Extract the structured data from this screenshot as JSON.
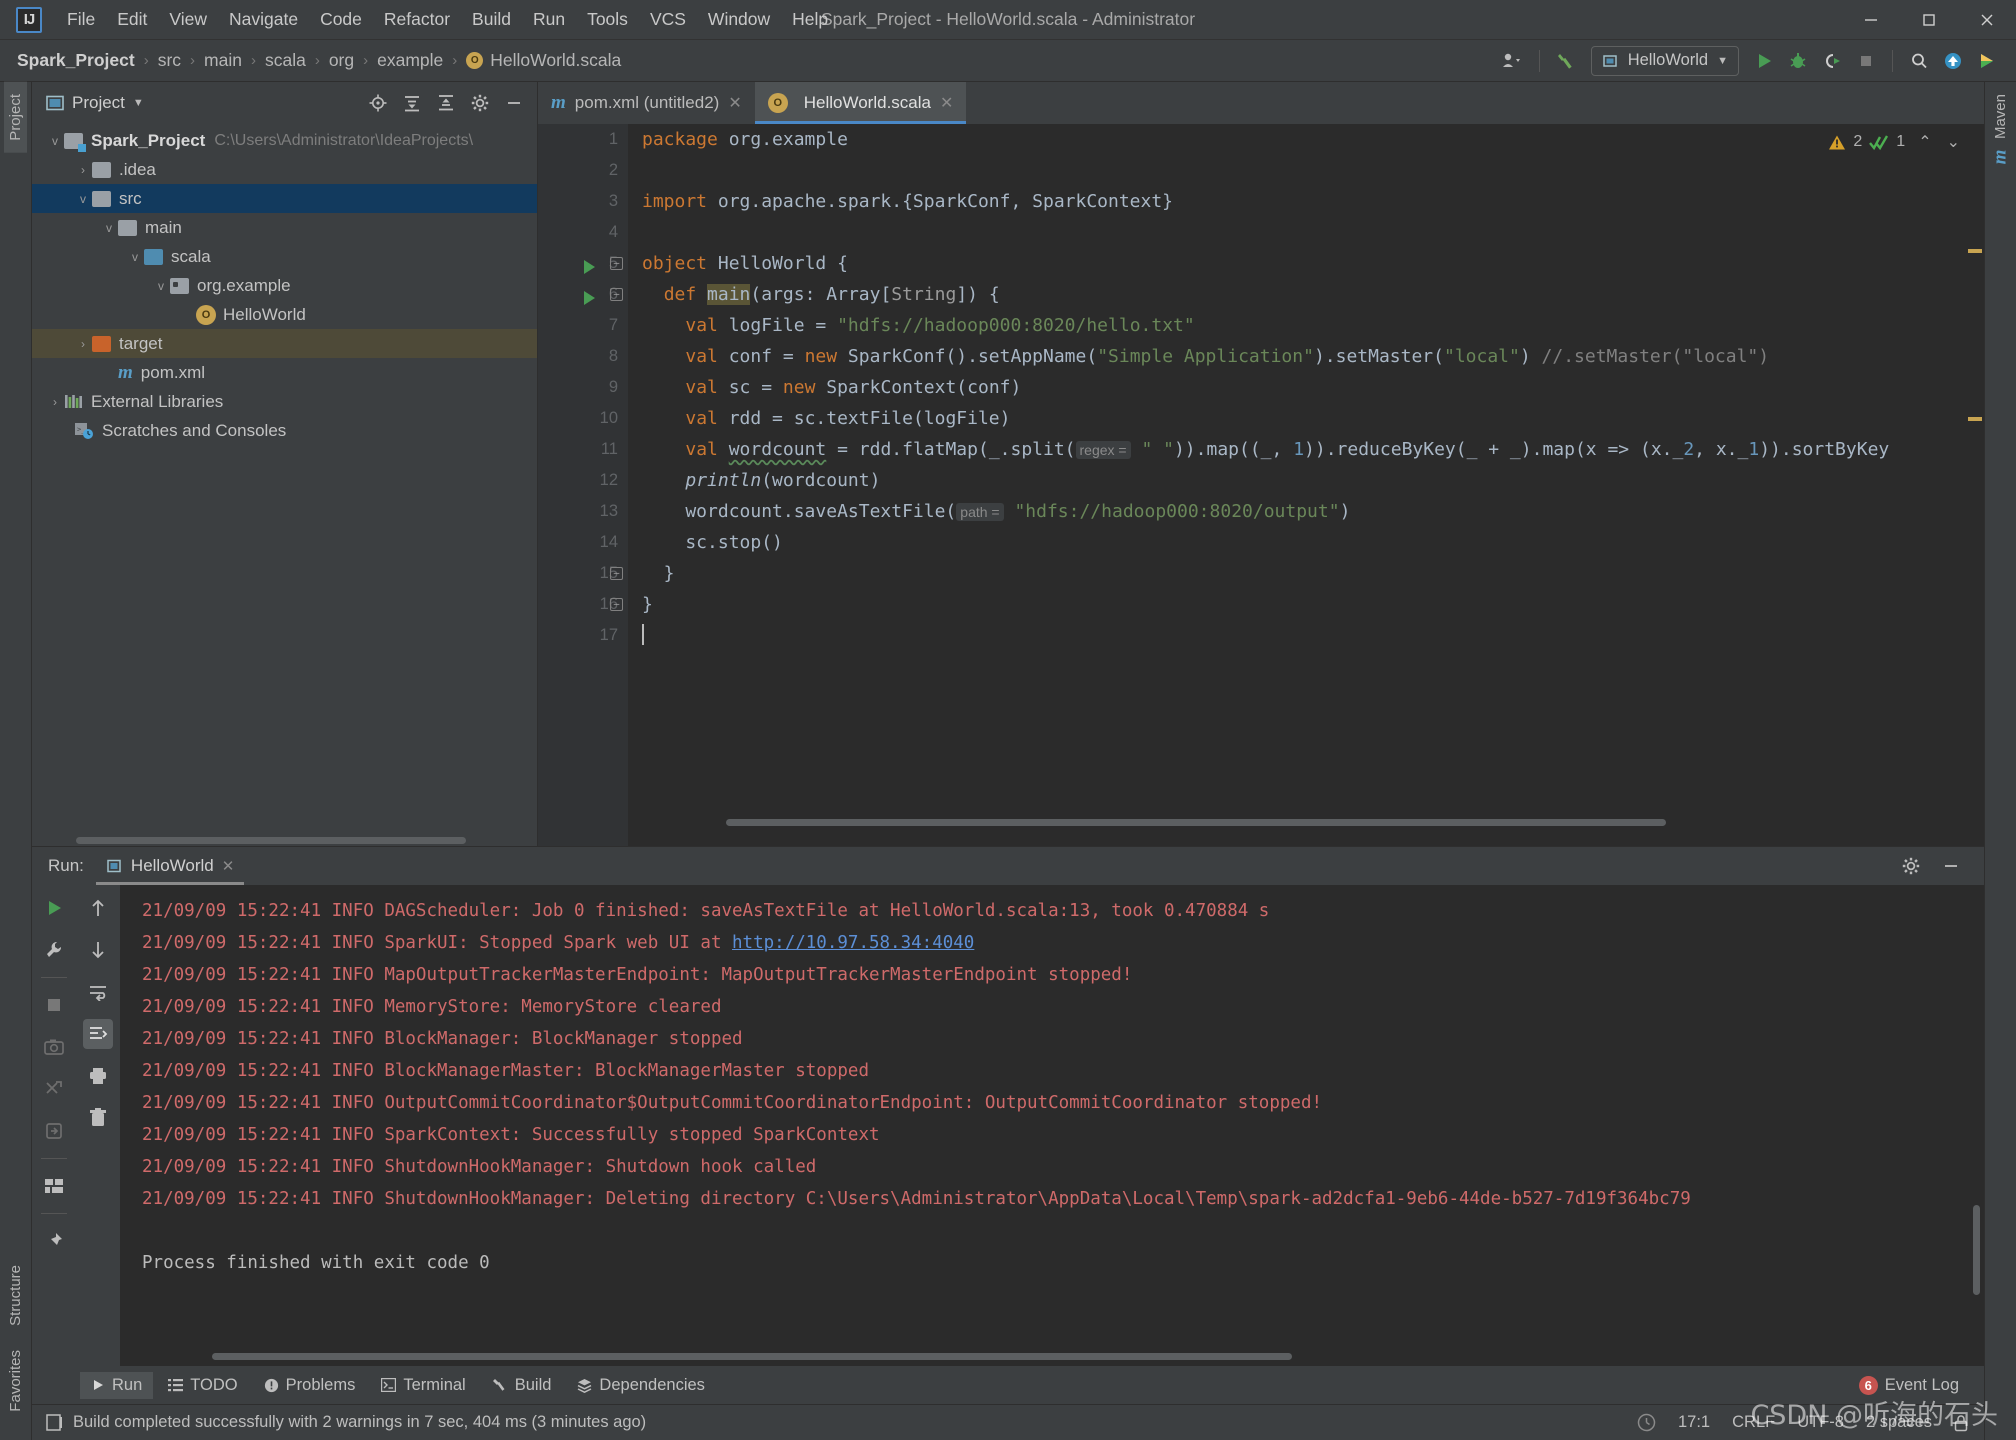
{
  "window": {
    "title": "Spark_Project - HelloWorld.scala - Administrator",
    "minimize": "—",
    "maximize": "☐",
    "close": "✕"
  },
  "menu": [
    {
      "label": "File"
    },
    {
      "label": "Edit"
    },
    {
      "label": "View"
    },
    {
      "label": "Navigate"
    },
    {
      "label": "Code"
    },
    {
      "label": "Refactor"
    },
    {
      "label": "Build"
    },
    {
      "label": "Run"
    },
    {
      "label": "Tools"
    },
    {
      "label": "VCS"
    },
    {
      "label": "Window"
    },
    {
      "label": "Help"
    }
  ],
  "breadcrumb": {
    "items": [
      "Spark_Project",
      "src",
      "main",
      "scala",
      "org",
      "example",
      "HelloWorld.scala"
    ],
    "separator": "›"
  },
  "toolbar": {
    "run_config": "HelloWorld",
    "icons": [
      "user-dropdown-icon",
      "build-hammer-icon",
      "run-icon",
      "debug-icon",
      "run-coverage-icon",
      "stop-icon",
      "search-everywhere-icon",
      "update-project-icon",
      "git-icon"
    ]
  },
  "left_rail": [
    {
      "label": "Project",
      "active": true
    },
    {
      "label": "Structure",
      "active": false
    },
    {
      "label": "Favorites",
      "active": false
    }
  ],
  "right_rail": [
    {
      "label": "Maven",
      "active": false
    }
  ],
  "project_panel": {
    "title": "Project",
    "header_icons": [
      "locate-icon",
      "expand-all-icon",
      "collapse-all-icon",
      "settings-gear-icon",
      "hide-icon"
    ],
    "tree": [
      {
        "label": "Spark_Project",
        "path": "C:\\Users\\Administrator\\IdeaProjects\\",
        "indent": 0,
        "arrow": "v",
        "icon": "module-folder",
        "bold": true,
        "state": "none"
      },
      {
        "label": ".idea",
        "path": "",
        "indent": 1,
        "arrow": ">",
        "icon": "grey-folder",
        "bold": false,
        "state": "none"
      },
      {
        "label": "src",
        "path": "",
        "indent": 1,
        "arrow": "v",
        "icon": "grey-folder",
        "bold": false,
        "state": "selected"
      },
      {
        "label": "main",
        "path": "",
        "indent": 2,
        "arrow": "v",
        "icon": "grey-folder",
        "bold": false,
        "state": "none"
      },
      {
        "label": "scala",
        "path": "",
        "indent": 3,
        "arrow": "v",
        "icon": "blue-folder",
        "bold": false,
        "state": "none"
      },
      {
        "label": "org.example",
        "path": "",
        "indent": 4,
        "arrow": "v",
        "icon": "package-folder",
        "bold": false,
        "state": "none"
      },
      {
        "label": "HelloWorld",
        "path": "",
        "indent": 5,
        "arrow": "",
        "icon": "scala-object",
        "bold": false,
        "state": "none"
      },
      {
        "label": "target",
        "path": "",
        "indent": 1,
        "arrow": ">",
        "icon": "orange-folder",
        "bold": false,
        "state": "highlighted"
      },
      {
        "label": "pom.xml",
        "path": "",
        "indent": 2,
        "arrow": "",
        "icon": "maven-file",
        "bold": false,
        "state": "none"
      },
      {
        "label": "External Libraries",
        "path": "",
        "indent": 0,
        "arrow": ">",
        "icon": "libraries",
        "bold": false,
        "state": "none"
      },
      {
        "label": "Scratches and Consoles",
        "path": "",
        "indent": 1,
        "arrow": "",
        "icon": "scratches",
        "bold": false,
        "state": "none"
      }
    ]
  },
  "editor": {
    "tabs": [
      {
        "label": "pom.xml (untitled2)",
        "icon": "maven-file-icon",
        "active": false
      },
      {
        "label": "HelloWorld.scala",
        "icon": "scala-object-icon",
        "active": true
      }
    ],
    "inspection": {
      "warning_count": "2",
      "ok_count": "1",
      "prev": "⌃",
      "next": "⌄"
    },
    "line_numbers": [
      "1",
      "2",
      "3",
      "4",
      "5",
      "6",
      "7",
      "8",
      "9",
      "10",
      "11",
      "12",
      "13",
      "14",
      "15",
      "16",
      "17"
    ],
    "code_lines": [
      {
        "n": 1,
        "text": "package org.example"
      },
      {
        "n": 2,
        "text": ""
      },
      {
        "n": 3,
        "text": "import org.apache.spark.{SparkConf, SparkContext}"
      },
      {
        "n": 4,
        "text": ""
      },
      {
        "n": 5,
        "text": "object HelloWorld {"
      },
      {
        "n": 6,
        "text": "  def main(args: Array[String]) {"
      },
      {
        "n": 7,
        "text": "    val logFile = \"hdfs://hadoop000:8020/hello.txt\""
      },
      {
        "n": 8,
        "text": "    val conf = new SparkConf().setAppName(\"Simple Application\").setMaster(\"local\") //.setMaster(\"local\")"
      },
      {
        "n": 9,
        "text": "    val sc = new SparkContext(conf)"
      },
      {
        "n": 10,
        "text": "    val rdd = sc.textFile(logFile)"
      },
      {
        "n": 11,
        "text": "    val wordcount = rdd.flatMap(_.split( regex = \" \")).map((_, 1)).reduceByKey(_ + _).map(x => (x._2, x._1)).sortByKey"
      },
      {
        "n": 12,
        "text": "    println(wordcount)"
      },
      {
        "n": 13,
        "text": "    wordcount.saveAsTextFile( path = \"hdfs://hadoop000:8020/output\")"
      },
      {
        "n": 14,
        "text": "    sc.stop()"
      },
      {
        "n": 15,
        "text": "  }"
      },
      {
        "n": 16,
        "text": "}"
      },
      {
        "n": 17,
        "text": ""
      }
    ],
    "inlay_hints": [
      "regex =",
      "path ="
    ]
  },
  "run_panel": {
    "label": "Run:",
    "tab": "HelloWorld",
    "close": "✕",
    "side_buttons": [
      "rerun-icon",
      "settings-wrench-icon",
      "stop-icon",
      "screenshot-icon",
      "dump-threads-icon",
      "export-icon",
      "layout-icon",
      "pin-icon"
    ],
    "side_buttons_2": [
      "scroll-up-icon",
      "scroll-down-icon",
      "soft-wrap-icon",
      "scroll-to-end-icon",
      "print-icon",
      "clear-all-icon"
    ],
    "header_icons": [
      "settings-gear-icon",
      "hide-icon"
    ],
    "console_lines": [
      {
        "type": "err",
        "text": "21/09/09 15:22:41 INFO DAGScheduler: Job 0 finished: saveAsTextFile at HelloWorld.scala:13, took 0.470884 s"
      },
      {
        "type": "err-link",
        "pre": "21/09/09 15:22:41 INFO SparkUI: Stopped Spark web UI at ",
        "link": "http://10.97.58.34:4040",
        "post": ""
      },
      {
        "type": "err",
        "text": "21/09/09 15:22:41 INFO MapOutputTrackerMasterEndpoint: MapOutputTrackerMasterEndpoint stopped!"
      },
      {
        "type": "err",
        "text": "21/09/09 15:22:41 INFO MemoryStore: MemoryStore cleared"
      },
      {
        "type": "err",
        "text": "21/09/09 15:22:41 INFO BlockManager: BlockManager stopped"
      },
      {
        "type": "err",
        "text": "21/09/09 15:22:41 INFO BlockManagerMaster: BlockManagerMaster stopped"
      },
      {
        "type": "err",
        "text": "21/09/09 15:22:41 INFO OutputCommitCoordinator$OutputCommitCoordinatorEndpoint: OutputCommitCoordinator stopped!"
      },
      {
        "type": "err",
        "text": "21/09/09 15:22:41 INFO SparkContext: Successfully stopped SparkContext"
      },
      {
        "type": "err",
        "text": "21/09/09 15:22:41 INFO ShutdownHookManager: Shutdown hook called"
      },
      {
        "type": "err",
        "text": "21/09/09 15:22:41 INFO ShutdownHookManager: Deleting directory C:\\Users\\Administrator\\AppData\\Local\\Temp\\spark-ad2dcfa1-9eb6-44de-b527-7d19f364bc79"
      },
      {
        "type": "blank",
        "text": ""
      },
      {
        "type": "out",
        "text": "Process finished with exit code 0"
      }
    ]
  },
  "tool_strip": {
    "items": [
      {
        "label": "Run",
        "icon": "run-icon",
        "active": true
      },
      {
        "label": "TODO",
        "icon": "todo-icon",
        "active": false
      },
      {
        "label": "Problems",
        "icon": "problems-icon",
        "active": false
      },
      {
        "label": "Terminal",
        "icon": "terminal-icon",
        "active": false
      },
      {
        "label": "Build",
        "icon": "build-hammer-icon",
        "active": false
      },
      {
        "label": "Dependencies",
        "icon": "dependencies-icon",
        "active": false
      }
    ],
    "event_log": {
      "label": "Event Log",
      "count": "6"
    }
  },
  "status_bar": {
    "message": "Build completed successfully with 2 warnings in 7 sec, 404 ms (3 minutes ago)",
    "caret": "17:1",
    "line_sep": "CRLF",
    "encoding": "UTF-8",
    "indent": "2 spaces",
    "lock": "lock-icon"
  },
  "watermark": "CSDN @听海的石头",
  "colors": {
    "accent": "#4a88c7",
    "keyword": "#cc7832",
    "string": "#6a8759",
    "number": "#6897bb",
    "comment": "#808080",
    "error_log": "#cf6a6a",
    "editor_bg": "#2b2b2b",
    "panel_bg": "#3c3f41"
  }
}
